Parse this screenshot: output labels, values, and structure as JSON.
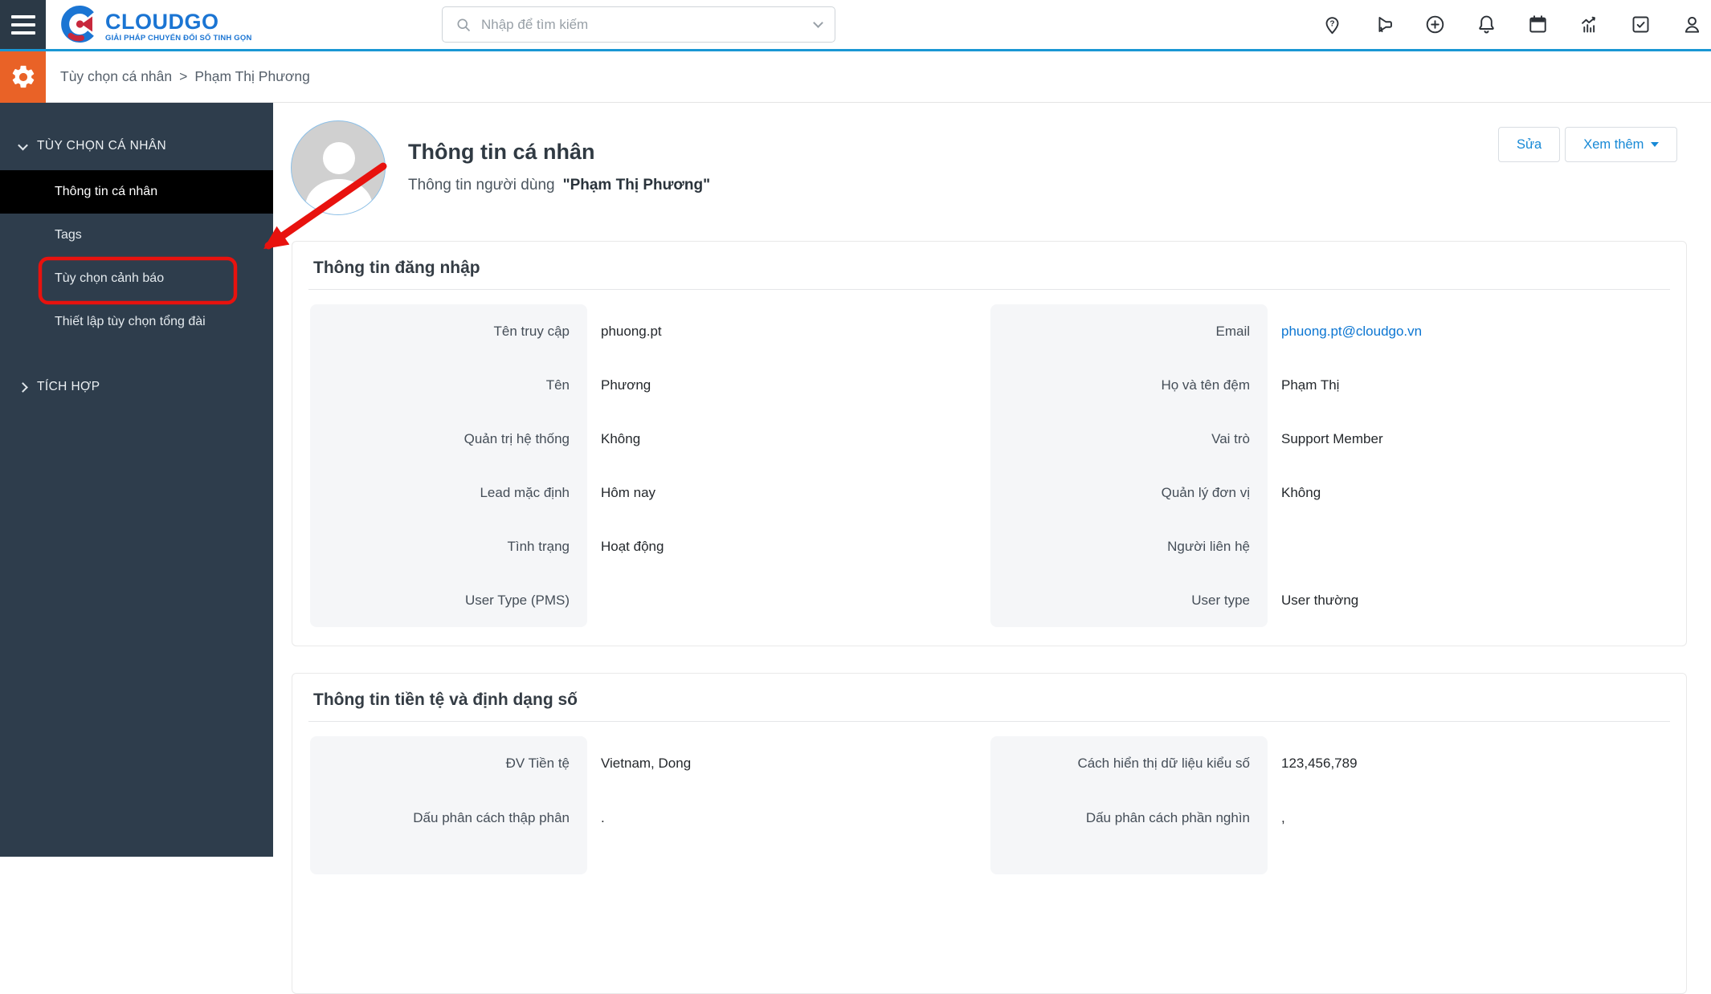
{
  "topbar": {
    "logo": {
      "text": "CLOUDGO",
      "tagline": "GIẢI PHÁP CHUYỂN ĐỔI SỐ TINH GỌN"
    },
    "search": {
      "placeholder": "Nhập để tìm kiếm"
    },
    "icons": [
      "help-pin",
      "megaphone",
      "plus-circle",
      "bell",
      "calendar",
      "analytics",
      "tasks",
      "user"
    ]
  },
  "breadcrumb": {
    "parts": [
      "Tùy chọn cá nhân",
      "Phạm Thị Phương"
    ],
    "separator": ">"
  },
  "sidebar": {
    "sections": [
      {
        "label": "TÙY CHỌN CÁ NHÂN",
        "expanded": true,
        "items": [
          {
            "label": "Thông tin cá nhân",
            "active": true
          },
          {
            "label": "Tags"
          },
          {
            "label": "Tùy chọn cảnh báo",
            "annotated": true
          },
          {
            "label": "Thiết lập tùy chọn tổng đài"
          }
        ]
      },
      {
        "label": "TÍCH HỢP",
        "expanded": false,
        "items": []
      }
    ]
  },
  "page_header": {
    "title": "Thông tin cá nhân",
    "subtitle_prefix": "Thông tin người dùng",
    "subtitle_name": "\"Phạm Thị Phương\"",
    "buttons": [
      {
        "label": "Sửa"
      },
      {
        "label": "Xem thêm",
        "has_caret": true
      }
    ]
  },
  "cards": [
    {
      "title": "Thông tin đăng nhập",
      "columns": {
        "left": [
          {
            "label": "Tên truy cập",
            "value": "phuong.pt"
          },
          {
            "label": "Tên",
            "value": "Phương"
          },
          {
            "label": "Quản trị hệ thống",
            "value": "Không"
          },
          {
            "label": "Lead mặc định",
            "value": "Hôm nay"
          },
          {
            "label": "Tình trạng",
            "value": "Hoạt động"
          },
          {
            "label": "User Type (PMS)",
            "value": ""
          }
        ],
        "right": [
          {
            "label": "Email",
            "value": "phuong.pt@cloudgo.vn",
            "link": true
          },
          {
            "label": "Họ và tên đệm",
            "value": "Phạm Thị"
          },
          {
            "label": "Vai trò",
            "value": "Support Member"
          },
          {
            "label": "Quản lý đơn vị",
            "value": "Không"
          },
          {
            "label": "Người liên hệ",
            "value": ""
          },
          {
            "label": "User type",
            "value": "User thường"
          }
        ]
      }
    },
    {
      "title": "Thông tin tiền tệ và định dạng số",
      "columns": {
        "left": [
          {
            "label": "ĐV Tiền tệ",
            "value": "Vietnam, Dong"
          },
          {
            "label": "Dấu phân cách thập phân",
            "value": "."
          }
        ],
        "right": [
          {
            "label": "Cách hiển thị dữ liệu kiểu số",
            "value": "123,456,789"
          },
          {
            "label": "Dấu phân cách phần nghìn",
            "value": ","
          }
        ]
      }
    }
  ],
  "annotation": {
    "type": "red-box-and-arrow",
    "target": "Tùy chọn cảnh báo"
  },
  "colors": {
    "brand_blue": "#1b75d3",
    "accent_blue": "#1789d6",
    "link_blue": "#0c76d2",
    "topbar_line": "#1a97d4",
    "sidebar_bg": "#2e3d4c",
    "sidebar_active_bg": "#000000",
    "gear_orange": "#e96227",
    "annotation_red": "#e8120e",
    "label_panel": "#f5f6f8",
    "card_border": "#e9e9e9",
    "text_dark": "#24282c",
    "label_color": "#454e58",
    "muted": "#98a0a7"
  }
}
